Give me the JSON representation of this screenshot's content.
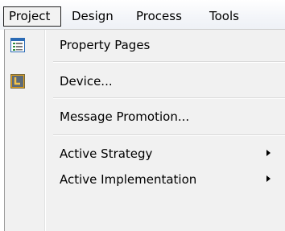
{
  "menubar": {
    "items": [
      "Project",
      "Design",
      "Process",
      "Tools"
    ]
  },
  "menu": {
    "items": [
      {
        "label": "Property Pages",
        "icon": "property-pages-icon",
        "submenu": false
      },
      {
        "label": "Device...",
        "icon": "device-icon",
        "submenu": false
      },
      {
        "label": "Message Promotion...",
        "icon": null,
        "submenu": false
      },
      {
        "label": "Active Strategy",
        "icon": null,
        "submenu": true
      },
      {
        "label": "Active Implementation",
        "icon": null,
        "submenu": true
      }
    ]
  },
  "colors": {
    "menu_background": "#f1f1f1",
    "selected_border": "#222222",
    "icon_green": "#2e8b3a",
    "icon_blue": "#2b6bb5",
    "icon_orange": "#f3a318"
  }
}
